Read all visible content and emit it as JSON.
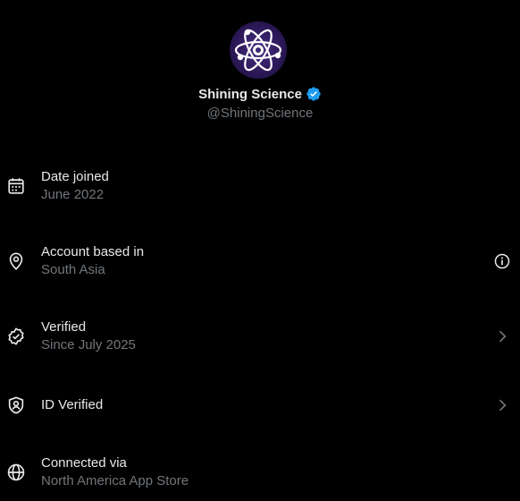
{
  "profile": {
    "name": "Shining Science",
    "handle": "@ShiningScience",
    "avatar_icon": "atom-icon",
    "verified_badge_color": "#1d9bf0"
  },
  "rows": [
    {
      "label": "Date joined",
      "value": "June 2022",
      "icon": "calendar-icon"
    },
    {
      "label": "Account based in",
      "value": "South Asia",
      "icon": "location-pin-icon",
      "trail": "info-icon"
    },
    {
      "label": "Verified",
      "value": "Since July 2025",
      "icon": "verified-check-icon",
      "trail": "chevron-right-icon"
    },
    {
      "label": "ID Verified",
      "icon": "shield-person-icon",
      "trail": "chevron-right-icon"
    },
    {
      "label": "Connected via",
      "value": "North America App Store",
      "icon": "globe-icon"
    }
  ],
  "colors": {
    "background": "#000000",
    "primary_text": "#e7e9ea",
    "secondary_text": "#71767b",
    "accent": "#1d9bf0"
  }
}
